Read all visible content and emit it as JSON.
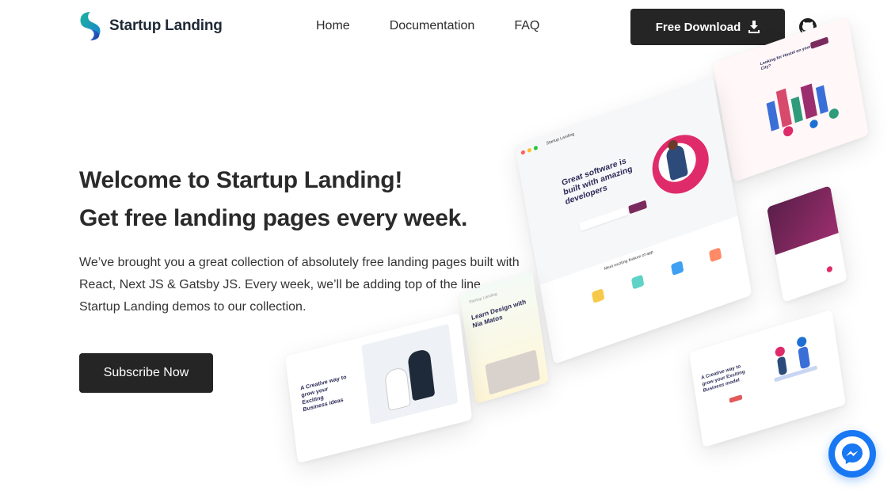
{
  "header": {
    "brand": "Startup Landing",
    "nav": [
      "Home",
      "Documentation",
      "FAQ"
    ],
    "download_label": "Free Download",
    "icons": {
      "download": "download-icon",
      "github": "github-icon"
    }
  },
  "hero": {
    "title_line1": "Welcome to Startup Landing!",
    "title_line2": "Get free landing pages every week.",
    "description": "We’ve brought you a great collection of absolutely free landing pages built with React, Next JS & Gatsby JS. Every week, we’ll be adding top of the line Startup Landing demos to our collection.",
    "subscribe_label": "Subscribe Now"
  },
  "mockups": {
    "main_brand": "Startup Landing",
    "main_headline": "Great software is built with amazing developers",
    "main_features": "Meet exciting feature of app",
    "top_right_headline": "Looking for Hostel on your City?",
    "learn_brand": "Startup Landing",
    "learn_headline": "Learn Design with Nia Matos",
    "bottom_left_headline": "A Creative way to grow your Exciting Business ideas",
    "bottom_right_headline": "A Creative way to grow your Exciting Business model"
  },
  "colors": {
    "dark_button": "#252525",
    "accent_pink": "#e02b6b",
    "accent_purple": "#7a2b5e",
    "messenger_blue": "#1877f2"
  },
  "floating": {
    "messenger_icon": "messenger-icon"
  }
}
